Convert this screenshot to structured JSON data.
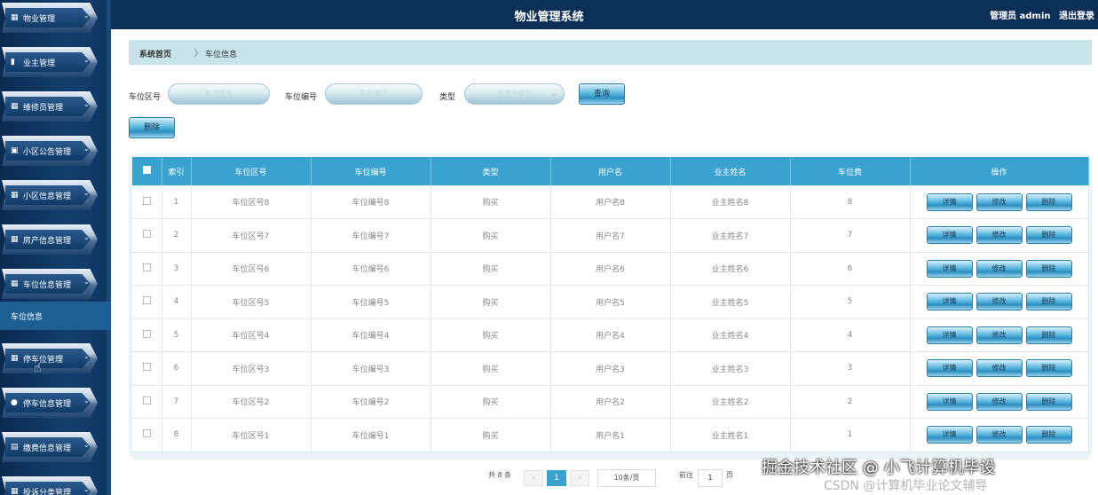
{
  "header": {
    "title": "物业管理系统",
    "user": "管理员 admin",
    "logout": "退出登录"
  },
  "sidebar": {
    "items": [
      {
        "label": "物业管理",
        "icon": "grid-icon"
      },
      {
        "label": "业主管理",
        "icon": "bar-icon"
      },
      {
        "label": "维修员管理",
        "icon": "grid-icon"
      },
      {
        "label": "小区公告管理",
        "icon": "doc-icon"
      },
      {
        "label": "小区信息管理",
        "icon": "grid-icon"
      },
      {
        "label": "房产信息管理",
        "icon": "grid-icon"
      },
      {
        "label": "车位信息管理",
        "icon": "grid-icon"
      },
      {
        "label": "停车位管理",
        "icon": "grid-icon"
      },
      {
        "label": "停车信息管理",
        "icon": "user-icon"
      },
      {
        "label": "缴费信息管理",
        "icon": "chart-icon"
      },
      {
        "label": "投诉分类管理",
        "icon": "grid-icon"
      }
    ],
    "active_sub": "车位信息"
  },
  "breadcrumb": {
    "home": "系统首页",
    "sep": "〉",
    "current": "车位信息"
  },
  "filters": {
    "area_label": "车位区号",
    "area_placeholder": "车位区号",
    "code_label": "车位编号",
    "code_placeholder": "车位编号",
    "type_label": "类型",
    "type_placeholder": "请选择类型",
    "search_button": "查询",
    "delete_button": "删除"
  },
  "table": {
    "headers": [
      "索引",
      "车位区号",
      "车位编号",
      "类型",
      "用户名",
      "业主姓名",
      "车位费",
      "操作"
    ],
    "action_labels": {
      "detail": "详情",
      "edit": "修改",
      "delete": "删除"
    },
    "rows": [
      {
        "index": "1",
        "area": "车位区号8",
        "code": "车位编号8",
        "type": "购买",
        "user": "用户名8",
        "owner": "业主姓名8",
        "fee": "8"
      },
      {
        "index": "2",
        "area": "车位区号7",
        "code": "车位编号7",
        "type": "购买",
        "user": "用户名7",
        "owner": "业主姓名7",
        "fee": "7"
      },
      {
        "index": "3",
        "area": "车位区号6",
        "code": "车位编号6",
        "type": "购买",
        "user": "用户名6",
        "owner": "业主姓名6",
        "fee": "6"
      },
      {
        "index": "4",
        "area": "车位区号5",
        "code": "车位编号5",
        "type": "购买",
        "user": "用户名5",
        "owner": "业主姓名5",
        "fee": "5"
      },
      {
        "index": "5",
        "area": "车位区号4",
        "code": "车位编号4",
        "type": "购买",
        "user": "用户名4",
        "owner": "业主姓名4",
        "fee": "4"
      },
      {
        "index": "6",
        "area": "车位区号3",
        "code": "车位编号3",
        "type": "购买",
        "user": "用户名3",
        "owner": "业主姓名3",
        "fee": "3"
      },
      {
        "index": "7",
        "area": "车位区号2",
        "code": "车位编号2",
        "type": "购买",
        "user": "用户名2",
        "owner": "业主姓名2",
        "fee": "2"
      },
      {
        "index": "8",
        "area": "车位区号1",
        "code": "车位编号1",
        "type": "购买",
        "user": "用户名1",
        "owner": "业主姓名1",
        "fee": "1"
      }
    ]
  },
  "pagination": {
    "total": "共 8 条",
    "prev": "‹",
    "current_page": "1",
    "next": "›",
    "page_size": "10条/页",
    "goto": "前往",
    "goto_value": "1",
    "page_suffix": "页"
  },
  "watermark": {
    "main": "掘金技术社区 @ 小飞计算机毕设",
    "sub": "CSDN @计算机毕业论文辅导"
  },
  "colors": {
    "topbar": "#0c2f57",
    "table_header": "#3aa2cf",
    "breadcrumb_bg": "#c9e3ea"
  }
}
